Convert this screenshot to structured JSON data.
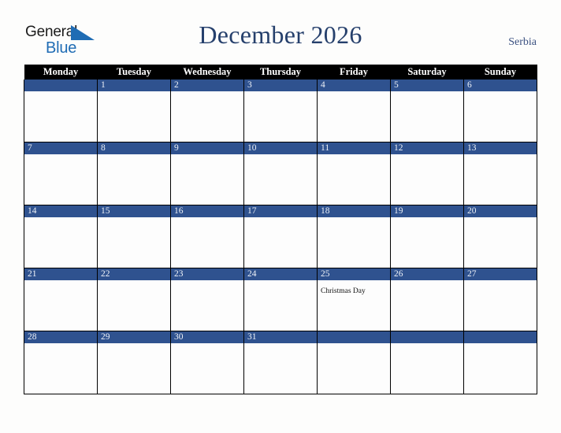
{
  "brand": {
    "word1": "General",
    "word2": "Blue",
    "triangle_icon": "triangle-right-icon",
    "word1_color": "#1b1b1b",
    "word2_color": "#1f6cb4",
    "triangle_color": "#1f6cb4"
  },
  "header": {
    "title": "December 2026",
    "country": "Serbia",
    "title_color": "#26406c",
    "country_color": "#3a5080"
  },
  "theme": {
    "background": "#fdfdfc",
    "weekday_header_bg": "#000000",
    "weekday_header_text": "#ffffff",
    "day_bar_bg": "#2f528f",
    "day_number_text": "#eef2f8",
    "cell_bg": "#fdfdfd",
    "grid_line": "#000000"
  },
  "weekdays": [
    "Monday",
    "Tuesday",
    "Wednesday",
    "Thursday",
    "Friday",
    "Saturday",
    "Sunday"
  ],
  "weeks": [
    [
      {
        "day": "",
        "event": ""
      },
      {
        "day": "1",
        "event": ""
      },
      {
        "day": "2",
        "event": ""
      },
      {
        "day": "3",
        "event": ""
      },
      {
        "day": "4",
        "event": ""
      },
      {
        "day": "5",
        "event": ""
      },
      {
        "day": "6",
        "event": ""
      }
    ],
    [
      {
        "day": "7",
        "event": ""
      },
      {
        "day": "8",
        "event": ""
      },
      {
        "day": "9",
        "event": ""
      },
      {
        "day": "10",
        "event": ""
      },
      {
        "day": "11",
        "event": ""
      },
      {
        "day": "12",
        "event": ""
      },
      {
        "day": "13",
        "event": ""
      }
    ],
    [
      {
        "day": "14",
        "event": ""
      },
      {
        "day": "15",
        "event": ""
      },
      {
        "day": "16",
        "event": ""
      },
      {
        "day": "17",
        "event": ""
      },
      {
        "day": "18",
        "event": ""
      },
      {
        "day": "19",
        "event": ""
      },
      {
        "day": "20",
        "event": ""
      }
    ],
    [
      {
        "day": "21",
        "event": ""
      },
      {
        "day": "22",
        "event": ""
      },
      {
        "day": "23",
        "event": ""
      },
      {
        "day": "24",
        "event": ""
      },
      {
        "day": "25",
        "event": "Christmas Day"
      },
      {
        "day": "26",
        "event": ""
      },
      {
        "day": "27",
        "event": ""
      }
    ],
    [
      {
        "day": "28",
        "event": ""
      },
      {
        "day": "29",
        "event": ""
      },
      {
        "day": "30",
        "event": ""
      },
      {
        "day": "31",
        "event": ""
      },
      {
        "day": "",
        "event": ""
      },
      {
        "day": "",
        "event": ""
      },
      {
        "day": "",
        "event": ""
      }
    ]
  ]
}
